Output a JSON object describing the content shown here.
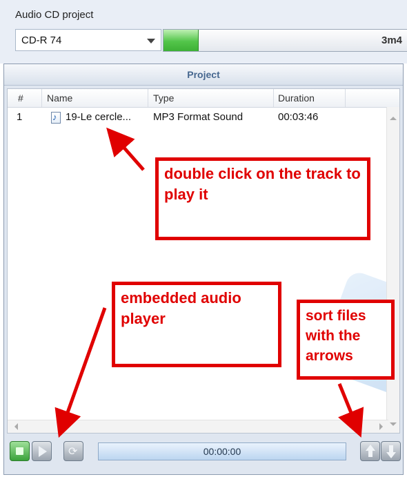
{
  "section": {
    "label": "Audio CD project"
  },
  "disc_type": {
    "value": "CD-R 74"
  },
  "capacity": {
    "text": "3m4",
    "fill_fraction": 0.14,
    "fill_color": "#4cbf44"
  },
  "project": {
    "title": "Project"
  },
  "columns": [
    {
      "label": "#"
    },
    {
      "label": "Name"
    },
    {
      "label": "Type"
    },
    {
      "label": "Duration"
    }
  ],
  "tracks": [
    {
      "number": "1",
      "name": "19-Le cercle...",
      "type": "MP3 Format Sound",
      "duration": "00:03:46",
      "icon": "music-note-icon"
    }
  ],
  "player": {
    "time": "00:00:00",
    "buttons": [
      "stop-icon",
      "play-icon",
      "loop-icon",
      "arrow-up-icon",
      "arrow-down-icon"
    ]
  },
  "annotations": {
    "play_hint": "double click on the track to play it",
    "player_hint": "embedded audio player",
    "sort_hint": "sort files with the arrows",
    "color": "#e00000"
  }
}
